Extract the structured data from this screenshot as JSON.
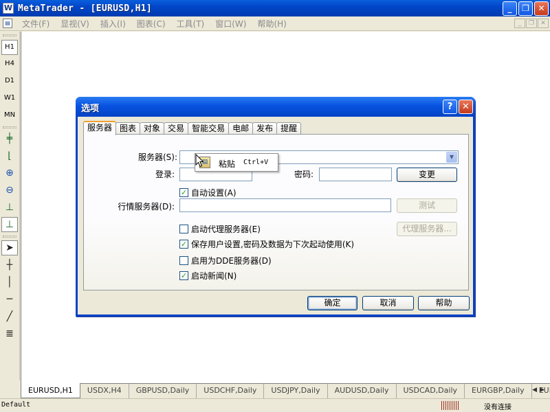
{
  "window": {
    "title": "MetaTrader - [EURUSD,H1]",
    "minimize": "_",
    "restore": "❐",
    "close": "✕"
  },
  "menu": [
    "文件(F)",
    "显视(V)",
    "插入(I)",
    "图表(C)",
    "工具(T)",
    "窗口(W)",
    "帮助(H)"
  ],
  "toolbar": {
    "periods": [
      "H1",
      "H4",
      "D1",
      "W1",
      "MN"
    ]
  },
  "chart_tabs": [
    "EURUSD,H1",
    "USDX,H4",
    "GBPUSD,Daily",
    "USDCHF,Daily",
    "USDJPY,Daily",
    "AUDUSD,Daily",
    "USDCAD,Daily",
    "EURGBP,Daily",
    "EURJPY,"
  ],
  "status": {
    "profile": "Default",
    "connection": "没有连接"
  },
  "dialog": {
    "title": "选项",
    "help_button": "?",
    "close_button": "✕",
    "tabs": [
      "服务器",
      "图表",
      "对象",
      "交易",
      "智能交易",
      "电邮",
      "发布",
      "提醒"
    ],
    "server_label": "服务器(S):",
    "login_label": "登录:",
    "password_label": "密码:",
    "change_button": "变更",
    "auto_config_label": "自动设置(A)",
    "auto_config_checked": true,
    "quote_server_label": "行情服务器(D):",
    "test_button": "测试",
    "proxy_label": "启动代理服务器(E)",
    "proxy_checked": false,
    "proxy_button": "代理服务器...",
    "save_settings_label": "保存用户设置,密码及数据为下次起动使用(K)",
    "save_settings_checked": true,
    "dde_label": "启用为DDE服务器(D)",
    "dde_checked": false,
    "news_label": "启动新闻(N)",
    "news_checked": true,
    "ok_button": "确定",
    "cancel_button": "取消",
    "help_text_button": "帮助"
  },
  "context_menu": {
    "paste_label": "粘贴",
    "paste_shortcut": "Ctrl+V"
  },
  "colors": {
    "titlebar": "#0146c9",
    "check_mark": "#21a121"
  },
  "icons": {
    "app": "metatrader-icon",
    "paste": "paste-icon"
  }
}
